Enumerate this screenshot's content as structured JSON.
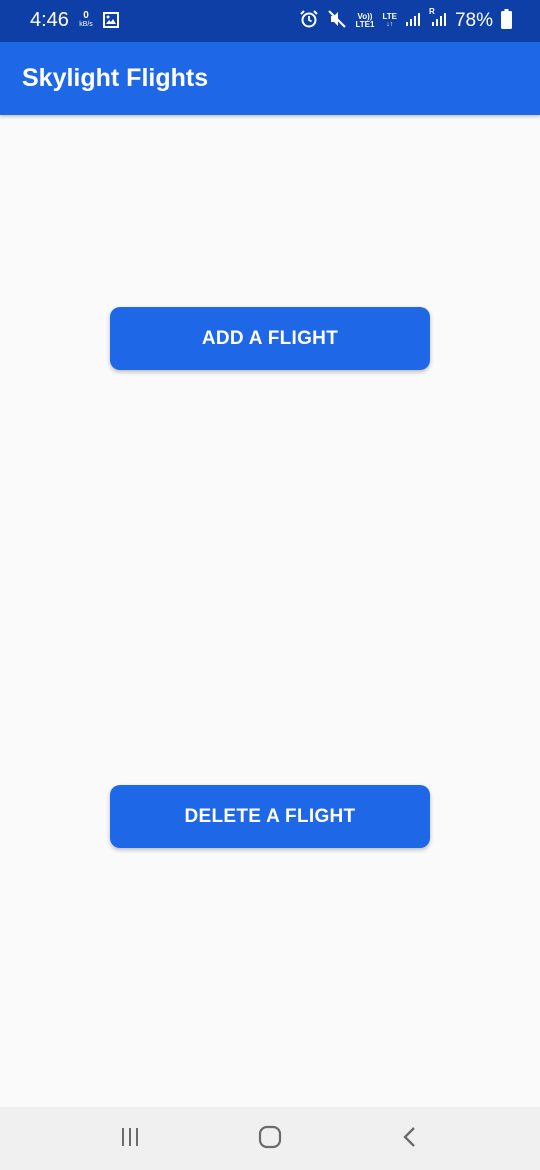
{
  "status_bar": {
    "time": "4:46",
    "data_speed_value": "0",
    "data_speed_unit": "kB/s",
    "network_top": "Vo))",
    "network_bottom": "LTE1",
    "network_type": "LTE",
    "roaming": "R",
    "battery_percent": "78%",
    "icons": [
      "gallery-icon",
      "alarm-icon",
      "mute-icon",
      "signal-icon",
      "signal-roaming-icon",
      "battery-icon"
    ]
  },
  "app_bar": {
    "title": "Skylight Flights"
  },
  "main": {
    "add_flight_label": "ADD A FLIGHT",
    "delete_flight_label": "DELETE A FLIGHT"
  },
  "nav_bar": {
    "buttons": [
      "recents-icon",
      "home-icon",
      "back-icon"
    ]
  },
  "colors": {
    "status_bar": "#0d3fa6",
    "primary": "#1e67e6",
    "background": "#fafafa",
    "nav_bar": "#f0f0f0"
  }
}
